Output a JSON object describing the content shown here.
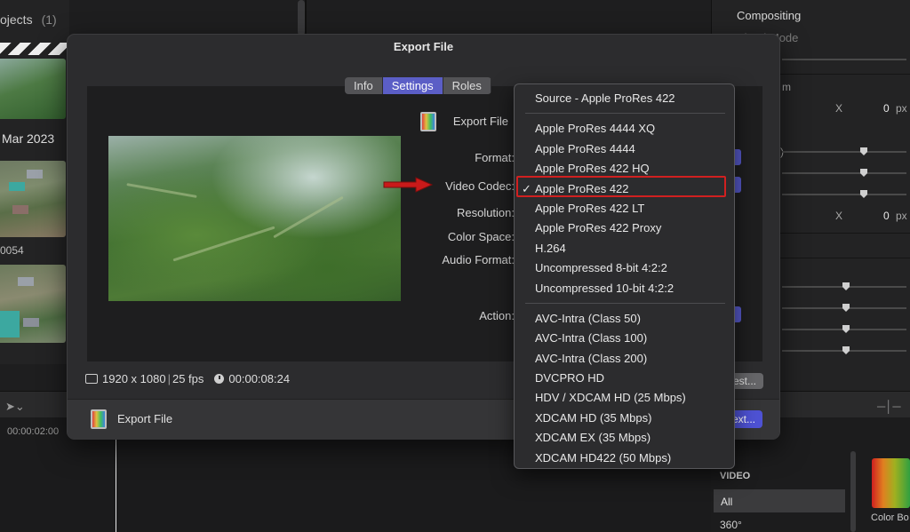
{
  "background": {
    "projects_label": "ojects",
    "projects_count": "(1)",
    "date_label": "Mar 2023",
    "clip_number": "0054",
    "timeline_time": "00:00:02:00",
    "inspector": {
      "title": "Compositing",
      "blend_mode_label": "Blend Mode",
      "rows": [
        {
          "label": "X",
          "value": "0",
          "unit": "px"
        },
        {
          "label": "X",
          "value": "0",
          "unit": "px"
        }
      ],
      "zoom_label": "m",
      "paren_label": ")"
    },
    "browser": {
      "heading": "VIDEO",
      "items": [
        "All",
        "360°"
      ],
      "swatch_label": "Color Bo"
    }
  },
  "dialog": {
    "title": "Export File",
    "tabs": [
      {
        "label": "Info",
        "active": false
      },
      {
        "label": "Settings",
        "active": true
      },
      {
        "label": "Roles",
        "active": false
      }
    ],
    "settings_labels": {
      "export_file": "Export File",
      "format": "Format:",
      "video_codec": "Video Codec:",
      "resolution": "Resolution:",
      "color_space": "Color Space:",
      "audio_format": "Audio Format:",
      "action": "Action:"
    },
    "info_bar": {
      "resolution": "1920 x 1080",
      "fps": "25 fps",
      "duration": "00:00:08:24"
    },
    "footer": {
      "label": "Export File",
      "test_button": "Test...",
      "next_button": "Next..."
    }
  },
  "codec_menu": {
    "selected": "Apple ProRes 422",
    "groups": [
      [
        "Source - Apple ProRes 422"
      ],
      [
        "Apple ProRes 4444 XQ",
        "Apple ProRes 4444",
        "Apple ProRes 422 HQ",
        "Apple ProRes 422",
        "Apple ProRes 422 LT",
        "Apple ProRes 422 Proxy",
        "H.264",
        "Uncompressed 8-bit 4:2:2",
        "Uncompressed 10-bit 4:2:2"
      ],
      [
        "AVC-Intra (Class 50)",
        "AVC-Intra (Class 100)",
        "AVC-Intra (Class 200)",
        "DVCPRO HD",
        "HDV / XDCAM HD (25 Mbps)",
        "XDCAM HD (35 Mbps)",
        "XDCAM EX (35 Mbps)",
        "XDCAM HD422 (50 Mbps)"
      ]
    ],
    "highlight_color": "#d12020",
    "accent_color": "#5b5ec6"
  }
}
